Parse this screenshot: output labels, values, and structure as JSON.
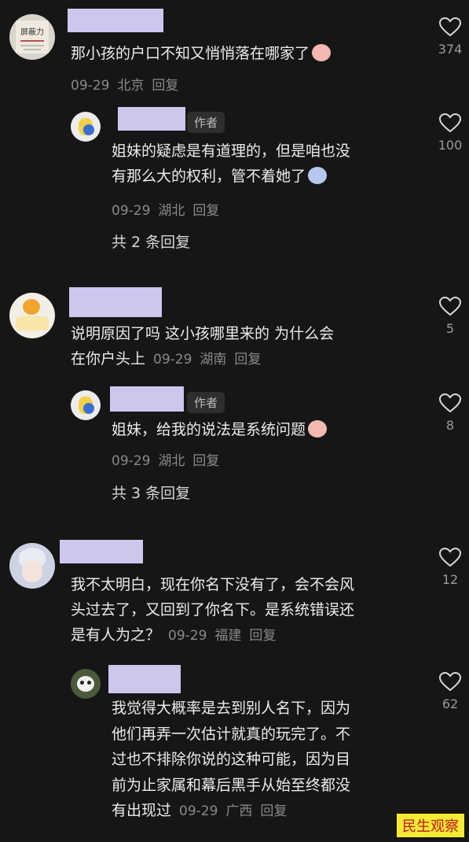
{
  "comments": [
    {
      "text_lines": [
        "那小孩的户口不知又悄悄落在哪家了"
      ],
      "date": "09-29",
      "location": "北京",
      "reply": "回复",
      "likes": "374",
      "replies": [
        {
          "author_tag": "作者",
          "text_lines": [
            "姐妹的疑虑是有道理的，但是咱也没",
            "有那么大的权利，管不着她了"
          ],
          "date": "09-29",
          "location": "湖北",
          "reply": "回复",
          "likes": "100"
        }
      ],
      "more_replies": "共 2 条回复"
    },
    {
      "text_lines": [
        "说明原因了吗   这小孩哪里来的 为什么会",
        "在你户头上"
      ],
      "date": "09-29",
      "location": "湖南",
      "reply": "回复",
      "likes": "5",
      "replies": [
        {
          "author_tag": "作者",
          "text_lines": [
            "姐妹，给我的说法是系统问题"
          ],
          "date": "09-29",
          "location": "湖北",
          "reply": "回复",
          "likes": "8"
        }
      ],
      "more_replies": "共 3 条回复"
    },
    {
      "text_lines": [
        "我不太明白，现在你名下没有了，会不会风",
        "头过去了，又回到了你名下。是系统错误还",
        "是有人为之？"
      ],
      "date": "09-29",
      "location": "福建",
      "reply": "回复",
      "likes": "12",
      "replies": [
        {
          "text_lines": [
            "我觉得大概率是去到别人名下，因为",
            "他们再弄一次估计就真的玩完了。不",
            "过也不排除你说的这种可能，因为目",
            "前为止家属和幕后黑手从始至终都没",
            "有出现过"
          ],
          "date": "09-29",
          "location": "广西",
          "reply": "回复",
          "likes": "62"
        }
      ]
    }
  ],
  "avatar_badge_text": "屏蔽力",
  "watermark": "民生观察",
  "colors": {
    "background": "#161616",
    "name_redaction": "#cfc6ee",
    "meta": "#8a8a8a",
    "watermark_bg": "#f5ea36",
    "watermark_fg": "#c01818"
  }
}
